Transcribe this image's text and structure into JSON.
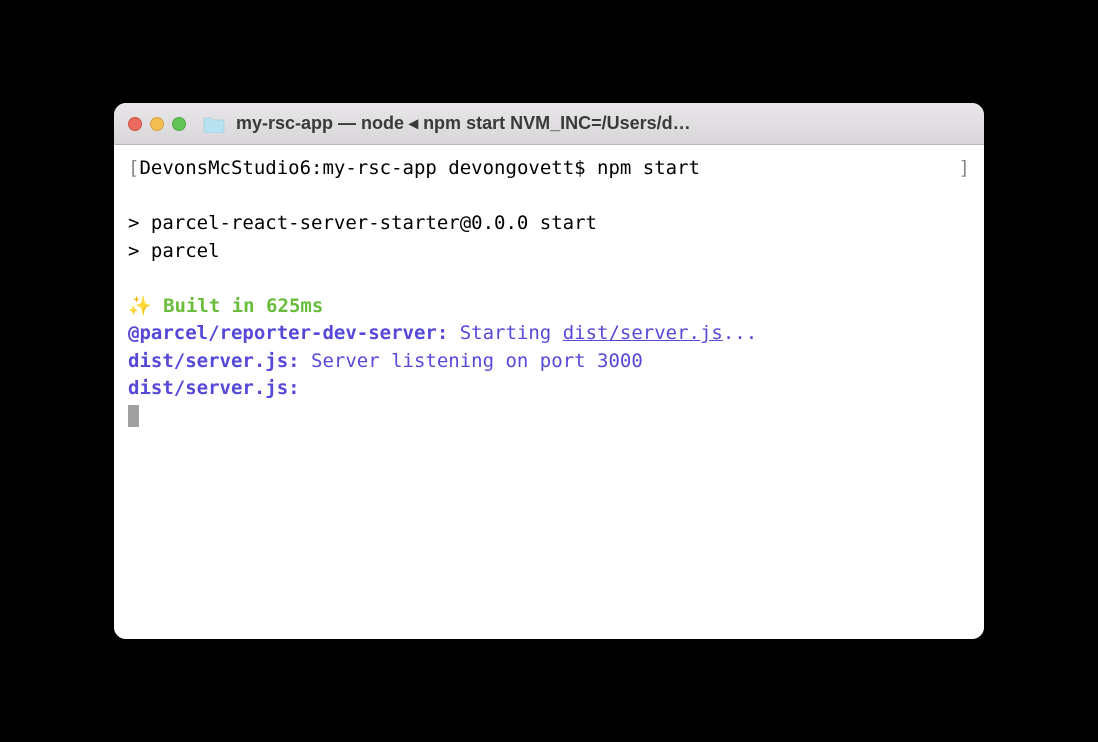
{
  "titleBar": {
    "title": "my-rsc-app — node ◂ npm start NVM_INC=/Users/d…"
  },
  "terminal": {
    "prompt": {
      "bracketLeft": "[",
      "host": "DevonsMcStudio6:my-rsc-app devongovett$ ",
      "command": "npm start",
      "bracketRight": "]"
    },
    "line1": "> parcel-react-server-starter@0.0.0 start",
    "line2": "> parcel",
    "built": {
      "sparkle": "✨ ",
      "text": "Built in 625ms"
    },
    "reporter1": {
      "label": "@parcel/reporter-dev-server:",
      "text1": " Starting ",
      "link": "dist/server.js",
      "text2": "..."
    },
    "reporter2": {
      "label": "dist/server.js:",
      "text": " Server listening on port 3000"
    },
    "reporter3": {
      "label": "dist/server.js:"
    }
  }
}
